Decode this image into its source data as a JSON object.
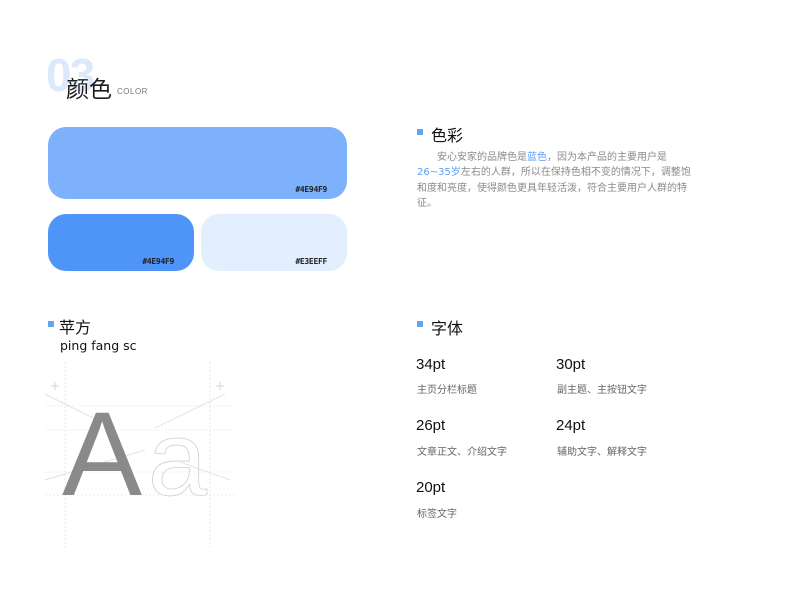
{
  "header": {
    "number": "03",
    "title": "颜色",
    "subtitle": "COLOR"
  },
  "swatches": [
    {
      "code": "#4E94F9",
      "color": "#7eb1fb"
    },
    {
      "code": "#4E94F9",
      "color": "#4e94f9"
    },
    {
      "code": "#E3EEFF",
      "color": "#e3eeff"
    }
  ],
  "color_section": {
    "title": "色彩",
    "desc_1": "安心安家的品牌色是",
    "desc_hl1": "蓝色",
    "desc_2": "，因为本产品的主要用户是",
    "desc_hl2": "26~35岁",
    "desc_3": "左右的人群，所以在保持色相不变的情况下，调整饱和度和亮度，使得颜色更具年轻活泼，符合主要用户人群的特征。"
  },
  "font_section": {
    "title": "苹方",
    "font_name": "ping fang sc",
    "specimen_upper": "A",
    "specimen_lower": "a"
  },
  "type_section": {
    "title": "字体",
    "sizes": [
      {
        "size": "34pt",
        "usage": "主页分栏标题"
      },
      {
        "size": "30pt",
        "usage": "副主题、主按钮文字"
      },
      {
        "size": "26pt",
        "usage": "文章正文、介绍文字"
      },
      {
        "size": "24pt",
        "usage": "辅助文字、解释文字"
      },
      {
        "size": "20pt",
        "usage": "标签文字"
      }
    ]
  },
  "colors": {
    "accent": "#5ea7f5",
    "highlight": "#5e9ef6"
  }
}
